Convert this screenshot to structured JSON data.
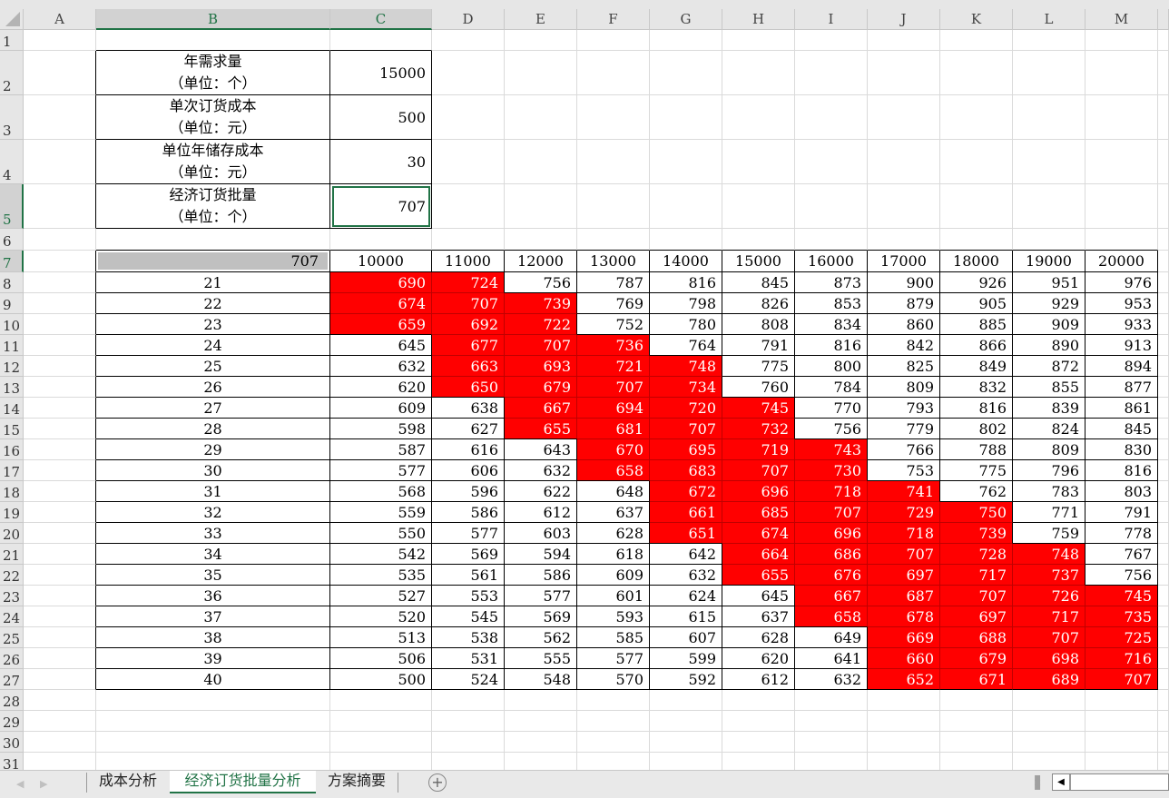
{
  "sheet": {
    "columns": [
      "A",
      "B",
      "C",
      "D",
      "E",
      "F",
      "G",
      "H",
      "I",
      "J",
      "K",
      "L",
      "M"
    ],
    "rows": [
      1,
      2,
      3,
      4,
      5,
      6,
      7,
      8,
      9,
      10,
      11,
      12,
      13,
      14,
      15,
      16,
      17,
      18,
      19,
      20,
      21,
      22,
      23,
      24,
      25,
      26,
      27,
      28,
      29,
      30,
      31
    ]
  },
  "params": [
    {
      "label_line1": "年需求量",
      "label_line2": "（单位：个）",
      "value": "15000"
    },
    {
      "label_line1": "单次订货成本",
      "label_line2": "（单位：元）",
      "value": "500"
    },
    {
      "label_line1": "单位年储存成本",
      "label_line2": "（单位：元）",
      "value": "30"
    },
    {
      "label_line1": "经济订货批量",
      "label_line2": "（单位：个）",
      "value": "707"
    }
  ],
  "table": {
    "corner_value": "707",
    "demand_headers": [
      "10000",
      "11000",
      "12000",
      "13000",
      "14000",
      "15000",
      "16000",
      "17000",
      "18000",
      "19000",
      "20000"
    ],
    "holding_costs": [
      "21",
      "22",
      "23",
      "24",
      "25",
      "26",
      "27",
      "28",
      "29",
      "30",
      "31",
      "32",
      "33",
      "34",
      "35",
      "36",
      "37",
      "38",
      "39",
      "40"
    ],
    "values": [
      [
        690,
        724,
        756,
        787,
        816,
        845,
        873,
        900,
        926,
        951,
        976
      ],
      [
        674,
        707,
        739,
        769,
        798,
        826,
        853,
        879,
        905,
        929,
        953
      ],
      [
        659,
        692,
        722,
        752,
        780,
        808,
        834,
        860,
        885,
        909,
        933
      ],
      [
        645,
        677,
        707,
        736,
        764,
        791,
        816,
        842,
        866,
        890,
        913
      ],
      [
        632,
        663,
        693,
        721,
        748,
        775,
        800,
        825,
        849,
        872,
        894
      ],
      [
        620,
        650,
        679,
        707,
        734,
        760,
        784,
        809,
        832,
        855,
        877
      ],
      [
        609,
        638,
        667,
        694,
        720,
        745,
        770,
        793,
        816,
        839,
        861
      ],
      [
        598,
        627,
        655,
        681,
        707,
        732,
        756,
        779,
        802,
        824,
        845
      ],
      [
        587,
        616,
        643,
        670,
        695,
        719,
        743,
        766,
        788,
        809,
        830
      ],
      [
        577,
        606,
        632,
        658,
        683,
        707,
        730,
        753,
        775,
        796,
        816
      ],
      [
        568,
        596,
        622,
        648,
        672,
        696,
        718,
        741,
        762,
        783,
        803
      ],
      [
        559,
        586,
        612,
        637,
        661,
        685,
        707,
        729,
        750,
        771,
        791
      ],
      [
        550,
        577,
        603,
        628,
        651,
        674,
        696,
        718,
        739,
        759,
        778
      ],
      [
        542,
        569,
        594,
        618,
        642,
        664,
        686,
        707,
        728,
        748,
        767
      ],
      [
        535,
        561,
        586,
        609,
        632,
        655,
        676,
        697,
        717,
        737,
        756
      ],
      [
        527,
        553,
        577,
        601,
        624,
        645,
        667,
        687,
        707,
        726,
        745
      ],
      [
        520,
        545,
        569,
        593,
        615,
        637,
        658,
        678,
        697,
        717,
        735
      ],
      [
        513,
        538,
        562,
        585,
        607,
        628,
        649,
        669,
        688,
        707,
        725
      ],
      [
        506,
        531,
        555,
        577,
        599,
        620,
        641,
        660,
        679,
        698,
        716
      ],
      [
        500,
        524,
        548,
        570,
        592,
        612,
        632,
        652,
        671,
        689,
        707
      ]
    ],
    "highlight_range": [
      650,
      750
    ],
    "highlight_color": "#ff0000"
  },
  "tabs": [
    {
      "label": "成本分析",
      "active": false
    },
    {
      "label": "经济订货批量分析",
      "active": true
    },
    {
      "label": "方案摘要",
      "active": false
    }
  ],
  "accent_color": "#217346"
}
